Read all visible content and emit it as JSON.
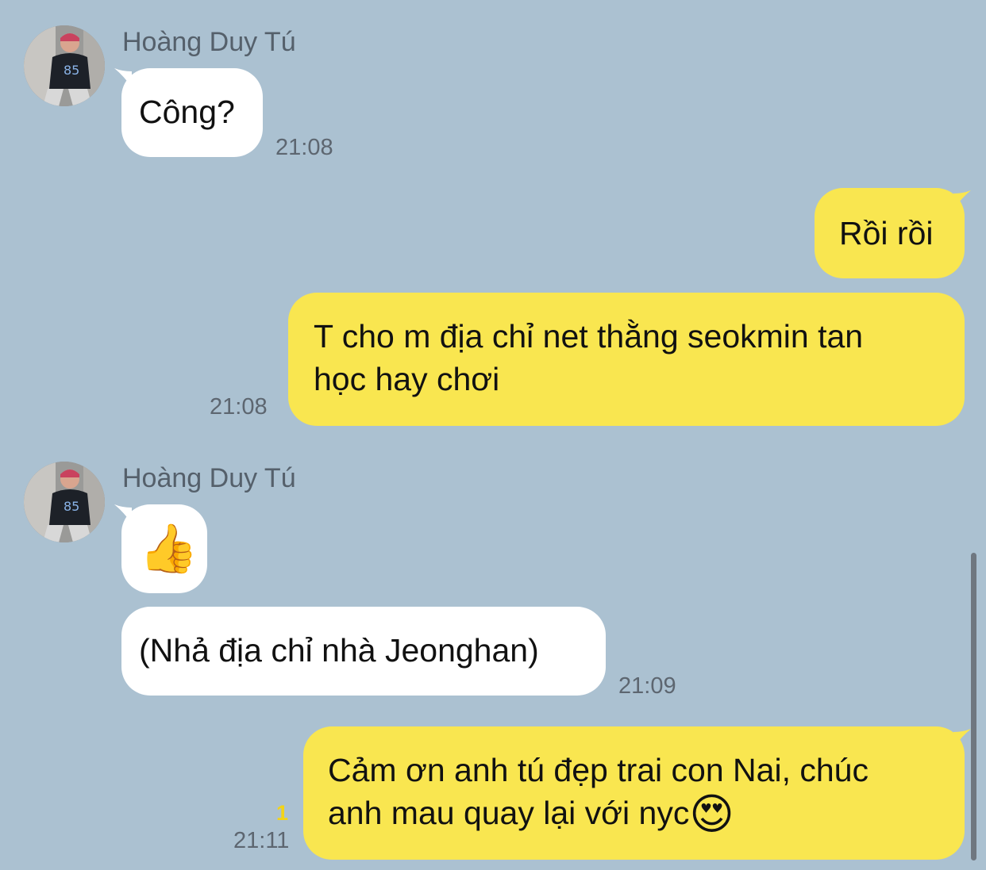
{
  "chat": {
    "contact_name": "Hoàng Duy Tú",
    "messages": [
      {
        "text": "Công?",
        "time": "21:08"
      },
      {
        "text": "Rồi rồi"
      },
      {
        "line1": "T cho m địa chỉ net thằng seokmin tan",
        "line2": "học hay chơi",
        "time": "21:08"
      },
      {
        "emoji": "👍"
      },
      {
        "text": "(Nhả địa chỉ nhà Jeonghan)",
        "time": "21:09"
      },
      {
        "line1": "Cảm ơn anh tú đẹp trai con Nai, chúc",
        "line2": "anh mau quay lại với nyc",
        "emoji": "😍",
        "time": "21:11",
        "unread": "1"
      }
    ]
  },
  "colors": {
    "background": "#abc1d1",
    "incoming_bubble": "#ffffff",
    "outgoing_bubble": "#f9e650",
    "unread_count": "#f3d417"
  }
}
